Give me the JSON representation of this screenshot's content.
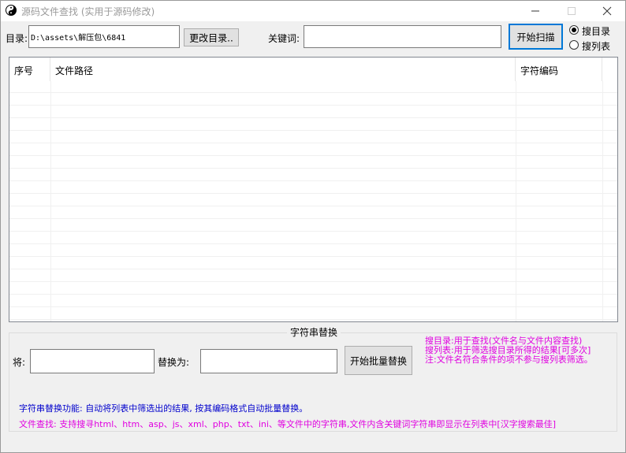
{
  "window": {
    "title": "源码文件查找 (实用于源码修改)"
  },
  "top": {
    "dir_label": "目录:",
    "dir_value": "D:\\assets\\解压包\\6841",
    "change_dir_button": "更改目录..",
    "keyword_label": "关键词:",
    "keyword_value": "",
    "scan_button": "开始扫描",
    "radio_dir": "搜目录",
    "radio_list": "搜列表",
    "radio_selected": "搜目录"
  },
  "list": {
    "columns": [
      "序号",
      "文件路径",
      "字符编码"
    ],
    "rows": []
  },
  "replace": {
    "group_title": "字符串替换",
    "from_label": "将:",
    "to_label": "替换为:",
    "from_value": "",
    "to_value": "",
    "batch_button": "开始批量替换"
  },
  "notes": {
    "line1": "搜目录:用于查找(文件名与文件内容查找)",
    "line2": "搜列表:用于筛选搜目录所得的结果[可多次]",
    "line3": "注:文件名符合条件的项不参与搜列表筛选。"
  },
  "footer": {
    "feature": "字符串替换功能: 自动将列表中筛选出的结果, 按其编码格式自动批量替换。",
    "search": "文件查找: 支持搜寻html、htm、asp、js、xml、php、txt、ini、等文件中的字符串,文件内含关键词字符串即显示在列表中[汉字搜索最佳]"
  },
  "colors": {
    "magenta": "#e000e0",
    "blue": "#0000cc",
    "default_button_border": "#0078d7"
  }
}
